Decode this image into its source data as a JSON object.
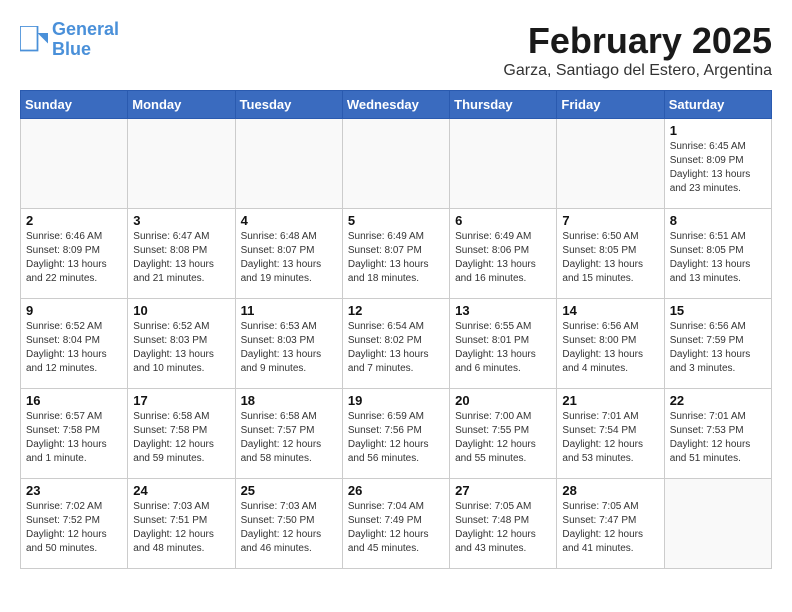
{
  "logo": {
    "line1": "General",
    "line2": "Blue"
  },
  "title": "February 2025",
  "subtitle": "Garza, Santiago del Estero, Argentina",
  "days_of_week": [
    "Sunday",
    "Monday",
    "Tuesday",
    "Wednesday",
    "Thursday",
    "Friday",
    "Saturday"
  ],
  "weeks": [
    [
      {
        "day": "",
        "info": ""
      },
      {
        "day": "",
        "info": ""
      },
      {
        "day": "",
        "info": ""
      },
      {
        "day": "",
        "info": ""
      },
      {
        "day": "",
        "info": ""
      },
      {
        "day": "",
        "info": ""
      },
      {
        "day": "1",
        "info": "Sunrise: 6:45 AM\nSunset: 8:09 PM\nDaylight: 13 hours\nand 23 minutes."
      }
    ],
    [
      {
        "day": "2",
        "info": "Sunrise: 6:46 AM\nSunset: 8:09 PM\nDaylight: 13 hours\nand 22 minutes."
      },
      {
        "day": "3",
        "info": "Sunrise: 6:47 AM\nSunset: 8:08 PM\nDaylight: 13 hours\nand 21 minutes."
      },
      {
        "day": "4",
        "info": "Sunrise: 6:48 AM\nSunset: 8:07 PM\nDaylight: 13 hours\nand 19 minutes."
      },
      {
        "day": "5",
        "info": "Sunrise: 6:49 AM\nSunset: 8:07 PM\nDaylight: 13 hours\nand 18 minutes."
      },
      {
        "day": "6",
        "info": "Sunrise: 6:49 AM\nSunset: 8:06 PM\nDaylight: 13 hours\nand 16 minutes."
      },
      {
        "day": "7",
        "info": "Sunrise: 6:50 AM\nSunset: 8:05 PM\nDaylight: 13 hours\nand 15 minutes."
      },
      {
        "day": "8",
        "info": "Sunrise: 6:51 AM\nSunset: 8:05 PM\nDaylight: 13 hours\nand 13 minutes."
      }
    ],
    [
      {
        "day": "9",
        "info": "Sunrise: 6:52 AM\nSunset: 8:04 PM\nDaylight: 13 hours\nand 12 minutes."
      },
      {
        "day": "10",
        "info": "Sunrise: 6:52 AM\nSunset: 8:03 PM\nDaylight: 13 hours\nand 10 minutes."
      },
      {
        "day": "11",
        "info": "Sunrise: 6:53 AM\nSunset: 8:03 PM\nDaylight: 13 hours\nand 9 minutes."
      },
      {
        "day": "12",
        "info": "Sunrise: 6:54 AM\nSunset: 8:02 PM\nDaylight: 13 hours\nand 7 minutes."
      },
      {
        "day": "13",
        "info": "Sunrise: 6:55 AM\nSunset: 8:01 PM\nDaylight: 13 hours\nand 6 minutes."
      },
      {
        "day": "14",
        "info": "Sunrise: 6:56 AM\nSunset: 8:00 PM\nDaylight: 13 hours\nand 4 minutes."
      },
      {
        "day": "15",
        "info": "Sunrise: 6:56 AM\nSunset: 7:59 PM\nDaylight: 13 hours\nand 3 minutes."
      }
    ],
    [
      {
        "day": "16",
        "info": "Sunrise: 6:57 AM\nSunset: 7:58 PM\nDaylight: 13 hours\nand 1 minute."
      },
      {
        "day": "17",
        "info": "Sunrise: 6:58 AM\nSunset: 7:58 PM\nDaylight: 12 hours\nand 59 minutes."
      },
      {
        "day": "18",
        "info": "Sunrise: 6:58 AM\nSunset: 7:57 PM\nDaylight: 12 hours\nand 58 minutes."
      },
      {
        "day": "19",
        "info": "Sunrise: 6:59 AM\nSunset: 7:56 PM\nDaylight: 12 hours\nand 56 minutes."
      },
      {
        "day": "20",
        "info": "Sunrise: 7:00 AM\nSunset: 7:55 PM\nDaylight: 12 hours\nand 55 minutes."
      },
      {
        "day": "21",
        "info": "Sunrise: 7:01 AM\nSunset: 7:54 PM\nDaylight: 12 hours\nand 53 minutes."
      },
      {
        "day": "22",
        "info": "Sunrise: 7:01 AM\nSunset: 7:53 PM\nDaylight: 12 hours\nand 51 minutes."
      }
    ],
    [
      {
        "day": "23",
        "info": "Sunrise: 7:02 AM\nSunset: 7:52 PM\nDaylight: 12 hours\nand 50 minutes."
      },
      {
        "day": "24",
        "info": "Sunrise: 7:03 AM\nSunset: 7:51 PM\nDaylight: 12 hours\nand 48 minutes."
      },
      {
        "day": "25",
        "info": "Sunrise: 7:03 AM\nSunset: 7:50 PM\nDaylight: 12 hours\nand 46 minutes."
      },
      {
        "day": "26",
        "info": "Sunrise: 7:04 AM\nSunset: 7:49 PM\nDaylight: 12 hours\nand 45 minutes."
      },
      {
        "day": "27",
        "info": "Sunrise: 7:05 AM\nSunset: 7:48 PM\nDaylight: 12 hours\nand 43 minutes."
      },
      {
        "day": "28",
        "info": "Sunrise: 7:05 AM\nSunset: 7:47 PM\nDaylight: 12 hours\nand 41 minutes."
      },
      {
        "day": "",
        "info": ""
      }
    ]
  ]
}
